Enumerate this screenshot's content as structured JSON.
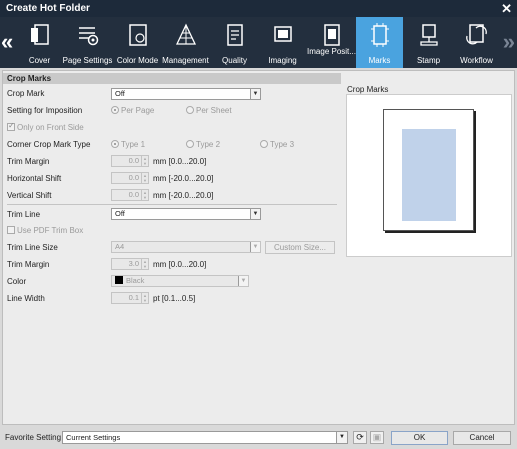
{
  "window": {
    "title": "Create Hot Folder",
    "close_glyph": "✕"
  },
  "toolbar": {
    "tabs": [
      {
        "label": "Cover",
        "icon": "cover-icon"
      },
      {
        "label": "Page Settings",
        "icon": "page-settings-icon"
      },
      {
        "label": "Color Mode",
        "icon": "color-mode-icon"
      },
      {
        "label": "Management",
        "icon": "management-icon"
      },
      {
        "label": "Quality",
        "icon": "quality-icon"
      },
      {
        "label": "Imaging",
        "icon": "imaging-icon"
      },
      {
        "label": "Image Posit...",
        "icon": "image-position-icon"
      },
      {
        "label": "Marks",
        "icon": "marks-icon",
        "active": true
      },
      {
        "label": "Stamp",
        "icon": "stamp-icon"
      },
      {
        "label": "Workflow",
        "icon": "workflow-icon"
      }
    ],
    "prev_glyph": "«",
    "next_glyph": "»",
    "active_color": "#4aa3df"
  },
  "crop_marks": {
    "section_title": "Crop Marks",
    "crop_mark_label": "Crop Mark",
    "crop_mark_value": "Off",
    "imposition_label": "Setting for Imposition",
    "imposition_options": [
      "Per Page",
      "Per Sheet"
    ],
    "front_side_label": "Only on Front Side",
    "corner_type_label": "Corner Crop Mark Type",
    "corner_types": [
      "Type 1",
      "Type 2",
      "Type 3"
    ],
    "trim_margin_label": "Trim Margin",
    "trim_margin_value": "0.0",
    "trim_margin_unit": "mm [0.0...20.0]",
    "h_shift_label": "Horizontal Shift",
    "h_shift_value": "0.0",
    "h_shift_unit": "mm [-20.0...20.0]",
    "v_shift_label": "Vertical Shift",
    "v_shift_value": "0.0",
    "v_shift_unit": "mm [-20.0...20.0]"
  },
  "trim_line": {
    "trim_line_label": "Trim Line",
    "trim_line_value": "Off",
    "pdf_trim_label": "Use PDF Trim Box",
    "size_label": "Trim Line Size",
    "size_value": "A4",
    "custom_size_label": "Custom Size...",
    "margin_label": "Trim Margin",
    "margin_value": "3.0",
    "margin_unit": "mm [0.0...20.0]",
    "color_label": "Color",
    "color_value": "Black",
    "width_label": "Line Width",
    "width_value": "0.1",
    "width_unit": "pt [0.1...0.5]"
  },
  "preview": {
    "title": "Crop Marks"
  },
  "footer": {
    "favorite_label": "Favorite Setting",
    "favorite_value": "Current Settings",
    "ok_label": "OK",
    "cancel_label": "Cancel"
  }
}
